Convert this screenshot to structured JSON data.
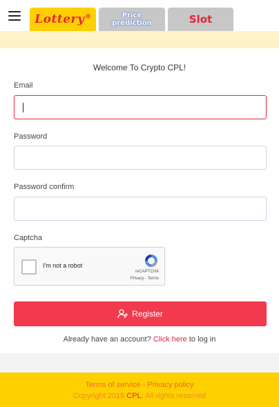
{
  "header": {
    "tabs": [
      {
        "label": "Lottery",
        "decoration": "✲"
      },
      {
        "label_line1": "Price",
        "label_line2": "prediction"
      },
      {
        "label": "Slot"
      }
    ]
  },
  "form": {
    "welcome": "Welcome To Crypto CPL!",
    "email_label": "Email",
    "email_value": "",
    "password_label": "Password",
    "password_value": "",
    "password_confirm_label": "Password confirm",
    "password_confirm_value": "",
    "captcha_label": "Captcha",
    "captcha": {
      "checkbox_label": "I'm not a robot",
      "brand": "reCAPTCHA",
      "privacy": "Privacy",
      "separator": " - ",
      "terms": "Terms"
    },
    "register_label": "Register",
    "login_prompt": "Already have an account?",
    "login_link": "Click here",
    "login_suffix": "to log in"
  },
  "footer": {
    "terms": "Terms of service",
    "separator": " - ",
    "privacy": "Privacy policy",
    "copyright_prefix": "Copyright 2018",
    "copyright_brand": "CPL",
    "copyright_suffix": ", All rights reserved"
  },
  "colors": {
    "accent_red": "#f23a4e",
    "brand_yellow": "#ffd000",
    "focus_border": "#e8233a"
  }
}
